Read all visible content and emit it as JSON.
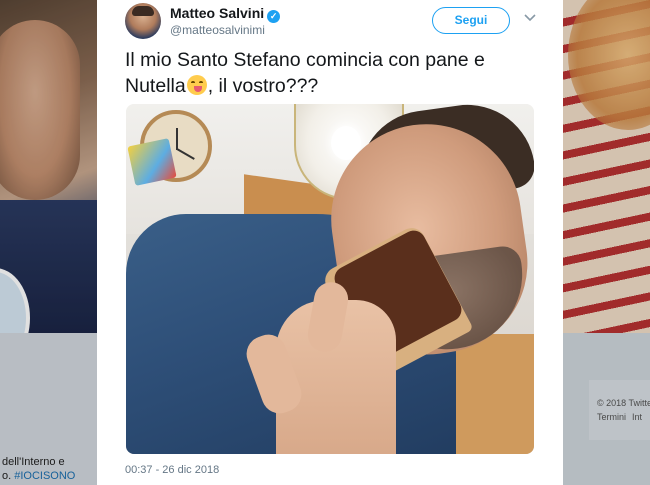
{
  "background": {
    "left_bio_line1": "dell'Interno e",
    "left_bio_line2_prefix": "o. ",
    "left_bio_hashtag": "#IOCISONO",
    "right_copyright": "© 2018 Twitte",
    "right_links": [
      "Termini",
      "Int"
    ]
  },
  "tweet": {
    "author_name": "Matteo Salvini",
    "author_handle": "@matteosalvinimi",
    "follow_label": "Segui",
    "text_before_emoji": "Il mio Santo Stefano comincia con pane e Nutella",
    "text_after_emoji": ", il vostro???",
    "timestamp": "00:37 - 26 dic 2018"
  },
  "icons": {
    "verified": "verified-badge-icon",
    "menu": "chevron-down-icon",
    "emoji": "face-savoring-food-emoji"
  },
  "colors": {
    "accent": "#1da1f2",
    "text": "#14171a",
    "secondary": "#657786",
    "page_bg": "#e6ecf0"
  }
}
